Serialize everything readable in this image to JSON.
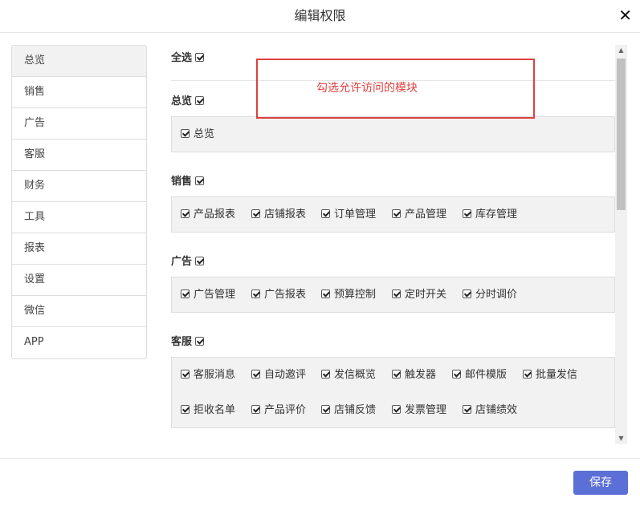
{
  "dialog": {
    "title": "编辑权限",
    "close_glyph": "✕",
    "save_label": "保存"
  },
  "sidebar": {
    "items": [
      {
        "label": "总览"
      },
      {
        "label": "销售"
      },
      {
        "label": "广告"
      },
      {
        "label": "客服"
      },
      {
        "label": "财务"
      },
      {
        "label": "工具"
      },
      {
        "label": "报表"
      },
      {
        "label": "设置"
      },
      {
        "label": "微信"
      },
      {
        "label": "APP"
      }
    ],
    "active": "总览"
  },
  "select_all": {
    "label": "全选",
    "checked": true
  },
  "hint": {
    "text": "勾选允许访问的模块",
    "border_color": "#e04040"
  },
  "groups": {
    "overview": {
      "title": "总览",
      "checked": true,
      "options": [
        "总览"
      ]
    },
    "sales": {
      "title": "销售",
      "checked": true,
      "options": [
        "产品报表",
        "店铺报表",
        "订单管理",
        "产品管理",
        "库存管理"
      ]
    },
    "ads": {
      "title": "广告",
      "checked": true,
      "options": [
        "广告管理",
        "广告报表",
        "预算控制",
        "定时开关",
        "分时调价"
      ]
    },
    "service": {
      "title": "客服",
      "checked": true,
      "options": [
        "客服消息",
        "自动邀评",
        "发信概览",
        "触发器",
        "邮件模版",
        "批量发信",
        "拒收名单",
        "产品评价",
        "店铺反馈",
        "发票管理",
        "店铺绩效"
      ]
    }
  },
  "colors": {
    "accent": "#5b6fd6",
    "checkbox_bg": "#f2f2f2"
  }
}
